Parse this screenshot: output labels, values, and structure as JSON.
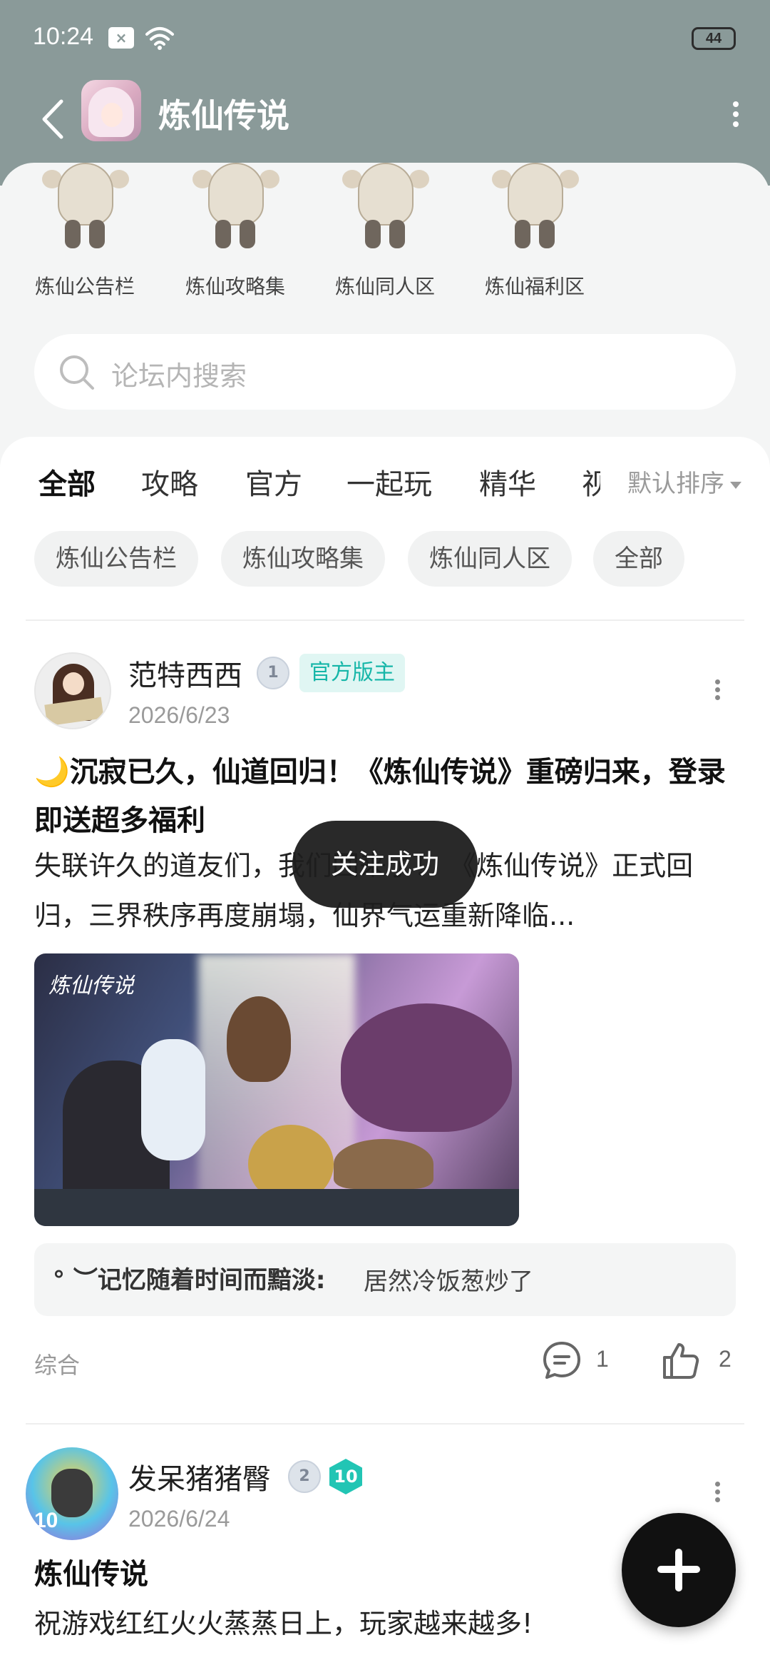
{
  "status_bar": {
    "time": "10:24",
    "sim_label": "×",
    "battery": "44"
  },
  "header": {
    "game_title": "炼仙传说"
  },
  "boards": [
    {
      "label": "炼仙公告栏"
    },
    {
      "label": "炼仙攻略集"
    },
    {
      "label": "炼仙同人区"
    },
    {
      "label": "炼仙福利区"
    }
  ],
  "search": {
    "placeholder": "论坛内搜索"
  },
  "tabs": [
    {
      "label": "全部"
    },
    {
      "label": "攻略"
    },
    {
      "label": "官方"
    },
    {
      "label": "一起玩"
    },
    {
      "label": "精华"
    },
    {
      "label": "视"
    }
  ],
  "sort": {
    "label": "默认排序"
  },
  "chips": [
    {
      "label": "炼仙公告栏"
    },
    {
      "label": "炼仙攻略集"
    },
    {
      "label": "炼仙同人区"
    },
    {
      "label": "全部"
    }
  ],
  "post1": {
    "author": "范特西西",
    "level": "1",
    "badge": "官方版主",
    "date": "2026/6/23",
    "title": "🌙沉寂已久，仙道回归！《炼仙传说》重磅归来，登录即送超多福利",
    "body": "失联许久的道友们，我们回来了！ 《炼仙传说》正式回归，三界秩序再度崩塌，仙界气运重新降临...",
    "image_caption": "炼仙传说",
    "comment_author": "°  ︶记忆随着时间而黯淡:",
    "comment_text": "居然冷饭葱炒了",
    "category": "综合",
    "comments": "1",
    "likes": "2"
  },
  "post2": {
    "author": "发呆猪猪臀",
    "level": "2",
    "badge": "10",
    "date": "2026/6/24",
    "title": "炼仙传说",
    "body": "祝游戏红红火火蒸蒸日上，玩家越来越多!",
    "avatar_text": "10"
  },
  "toast": {
    "text": "关注成功"
  },
  "colors": {
    "accent": "#12c2b6",
    "header_bg": "#8a9a99",
    "official_badge_bg": "#e0f6f3"
  }
}
